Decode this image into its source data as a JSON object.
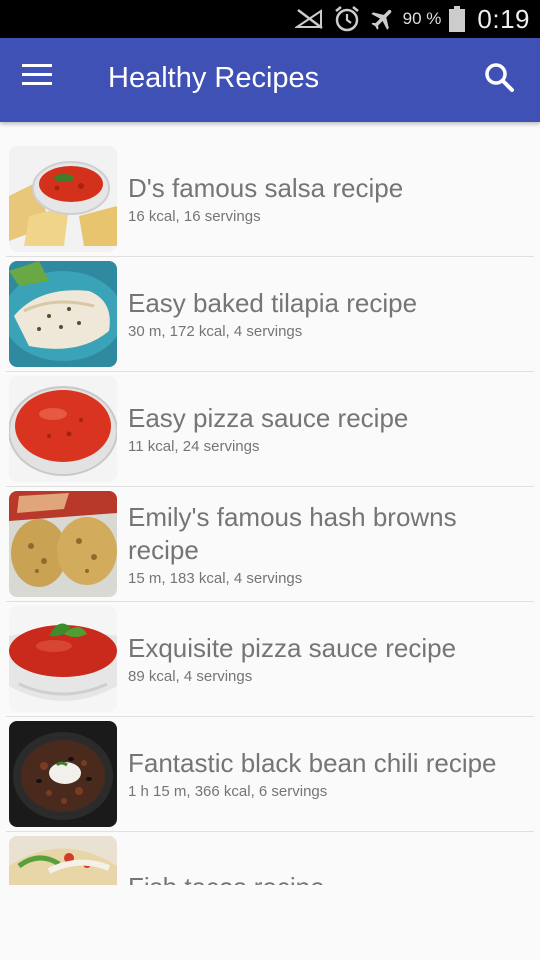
{
  "status_bar": {
    "battery_percent": "90 %",
    "time": "0:19",
    "icons": [
      "no-signal-icon",
      "alarm-icon",
      "airplane-mode-icon",
      "battery-icon"
    ]
  },
  "app_bar": {
    "title": "Healthy Recipes",
    "menu_icon": "hamburger-menu-icon",
    "search_icon": "search-icon",
    "color": "#3f51b5"
  },
  "recipes": [
    {
      "name": "D's famous salsa recipe",
      "meta": "16 kcal, 16 servings",
      "thumb": "salsa-bowl-with-chips"
    },
    {
      "name": "Easy baked tilapia recipe",
      "meta": "30 m, 172 kcal, 4 servings",
      "thumb": "baked-tilapia-fillet"
    },
    {
      "name": "Easy pizza sauce recipe",
      "meta": "11 kcal, 24 servings",
      "thumb": "pizza-sauce-glass-bowl"
    },
    {
      "name": "Emily's famous hash browns recipe",
      "meta": "15 m, 183 kcal, 4 servings",
      "thumb": "hash-browns-with-bacon"
    },
    {
      "name": "Exquisite pizza sauce recipe",
      "meta": "89 kcal, 4 servings",
      "thumb": "pizza-sauce-with-basil"
    },
    {
      "name": "Fantastic black bean chili recipe",
      "meta": "1 h 15 m, 366 kcal, 6 servings",
      "thumb": "black-bean-chili-bowl"
    },
    {
      "name": "Fish tacos recipe",
      "meta": "",
      "thumb": "fish-tacos"
    }
  ]
}
